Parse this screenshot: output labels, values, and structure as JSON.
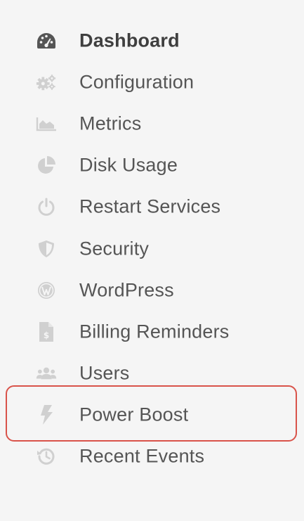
{
  "sidebar": {
    "items": [
      {
        "label": "Dashboard",
        "icon": "tachometer-icon",
        "active": true
      },
      {
        "label": "Configuration",
        "icon": "cogs-icon",
        "active": false
      },
      {
        "label": "Metrics",
        "icon": "area-chart-icon",
        "active": false
      },
      {
        "label": "Disk Usage",
        "icon": "pie-chart-icon",
        "active": false
      },
      {
        "label": "Restart Services",
        "icon": "power-icon",
        "active": false
      },
      {
        "label": "Security",
        "icon": "shield-icon",
        "active": false
      },
      {
        "label": "WordPress",
        "icon": "wordpress-icon",
        "active": false
      },
      {
        "label": "Billing Reminders",
        "icon": "invoice-icon",
        "active": false
      },
      {
        "label": "Users",
        "icon": "users-icon",
        "active": false
      },
      {
        "label": "Power Boost",
        "icon": "lightning-bolt-icon",
        "active": false,
        "highlighted": true
      },
      {
        "label": "Recent Events",
        "icon": "history-icon",
        "active": false
      }
    ]
  },
  "colors": {
    "background": "#f5f5f5",
    "label_text": "#555555",
    "active_text": "#3f3f3f",
    "icon_inactive": "#d0d0d0",
    "icon_active": "#555555",
    "highlight_border": "#d9534a"
  }
}
